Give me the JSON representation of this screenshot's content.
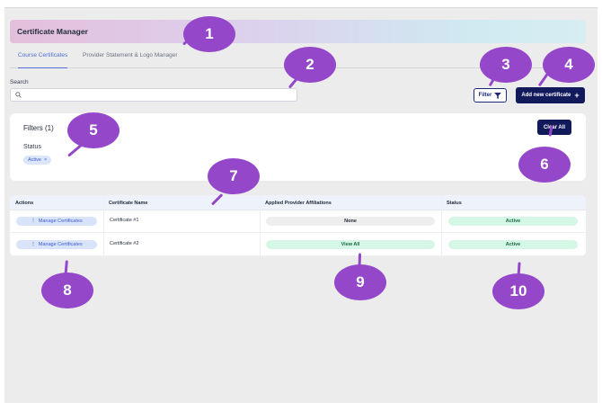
{
  "header": {
    "title": "Certificate Manager"
  },
  "tabs": [
    {
      "label": "Course Certificates",
      "active": true
    },
    {
      "label": "Provider Statement & Logo Manager",
      "active": false
    }
  ],
  "search": {
    "label": "Search",
    "value": "",
    "placeholder": ""
  },
  "toolbar": {
    "filter_label": "Filter",
    "add_label": "Add new certificate",
    "add_icon": "+"
  },
  "filters": {
    "title": "Filters (1)",
    "clear_label": "Clear All",
    "status_label": "Status",
    "chips": [
      {
        "label": "Active",
        "remove": "×"
      }
    ]
  },
  "table": {
    "columns": [
      "Actions",
      "Certificate Name",
      "Applied Provider Affiliations",
      "Status"
    ],
    "rows": [
      {
        "action": "Manage Certificates",
        "name": "Certificate #1",
        "affiliation": "None",
        "status": "Active"
      },
      {
        "action": "Manage Certificates",
        "name": "Certificate #2",
        "affiliation": "View All",
        "status": "Active"
      }
    ]
  },
  "markers": [
    "1",
    "2",
    "3",
    "4",
    "5",
    "6",
    "7",
    "8",
    "9",
    "10"
  ],
  "colors": {
    "primary": "#121a5c",
    "accent": "#4f6fd8",
    "marker": "#9448c9",
    "status_green": "#d4f7e6"
  },
  "icons": {
    "search": "search-icon",
    "filter": "filter-funnel-icon",
    "more": "vertical-dots-icon",
    "close": "close-icon",
    "plus": "plus-icon"
  }
}
